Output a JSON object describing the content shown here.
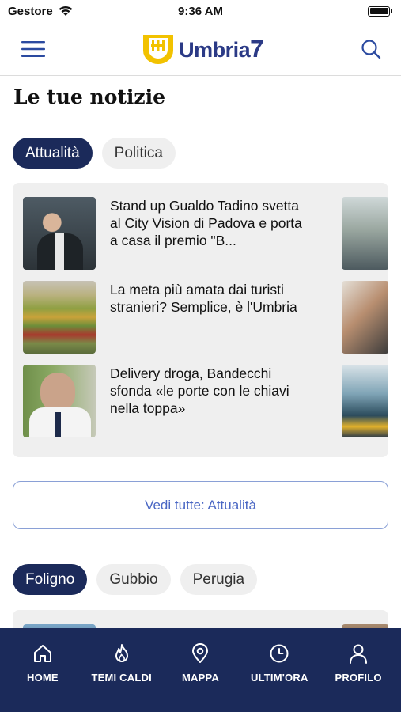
{
  "status": {
    "carrier": "Gestore",
    "time": "9:36 AM"
  },
  "header": {
    "logo_word": "Umbria",
    "logo_number": "7"
  },
  "section": {
    "title": "Le tue notizie"
  },
  "chips_primary": [
    {
      "label": "Attualità",
      "active": true
    },
    {
      "label": "Politica",
      "active": false
    }
  ],
  "news": [
    {
      "title": "Stand up Gualdo Tadino svetta al City Vision di Padova e porta a casa il premio \"B...",
      "image": "two-men-photo"
    },
    {
      "title": "La meta più amata dai turisti stranieri? Semplice, è l'Umbria",
      "image": "landscape-photo"
    },
    {
      "title": "Delivery droga, Bandecchi sfonda «le porte con le chiavi nella toppa»",
      "image": "speaker-photo"
    }
  ],
  "see_all": {
    "label": "Vedi tutte: Attualità"
  },
  "chips_secondary": [
    {
      "label": "Foligno",
      "active": true
    },
    {
      "label": "Gubbio",
      "active": false
    },
    {
      "label": "Perugia",
      "active": false
    }
  ],
  "tabs": [
    {
      "label": "HOME",
      "icon": "home-icon"
    },
    {
      "label": "TEMI CALDI",
      "icon": "flame-icon"
    },
    {
      "label": "MAPPA",
      "icon": "map-pin-icon"
    },
    {
      "label": "ULTIM'ORA",
      "icon": "clock-icon"
    },
    {
      "label": "PROFILO",
      "icon": "user-icon"
    }
  ],
  "colors": {
    "brand_navy": "#1b2a5a",
    "brand_blue": "#2b3a86",
    "logo_yellow": "#f2c200",
    "link_blue": "#4a67c4"
  }
}
